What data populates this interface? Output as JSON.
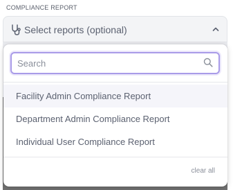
{
  "field": {
    "label": "COMPLIANCE REPORT",
    "placeholder": "Select reports (optional)"
  },
  "dropdown": {
    "search_placeholder": "Search",
    "options": [
      {
        "label": "Facility Admin Compliance Report",
        "active": true
      },
      {
        "label": "Department Admin Compliance Report",
        "active": false
      },
      {
        "label": "Individual User Compliance Report",
        "active": false
      }
    ],
    "clear_label": "clear all"
  },
  "icons": {
    "select": "stethoscope-icon",
    "toggle": "chevron-up-icon",
    "search": "search-icon"
  },
  "colors": {
    "focus_border": "#a99be8",
    "text": "#5b6170",
    "muted": "#8a8f9a"
  }
}
